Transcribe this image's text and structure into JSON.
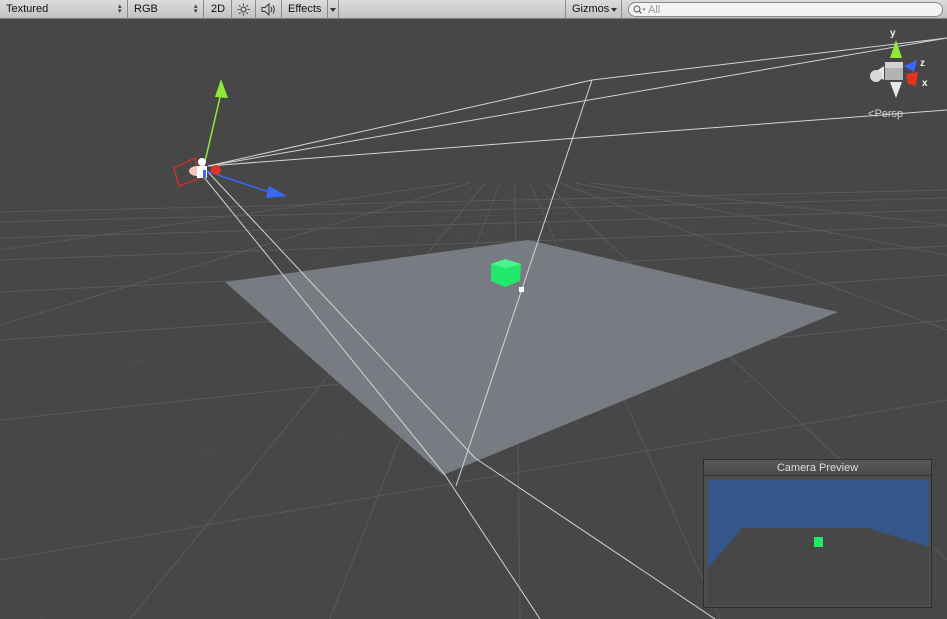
{
  "toolbar": {
    "shading_mode": "Textured",
    "render_channel": "RGB",
    "mode_2d_label": "2D",
    "lighting_icon": "sun-icon",
    "audio_icon": "speaker-icon",
    "effects_label": "Effects",
    "gizmos_label": "Gizmos",
    "search_placeholder": "All"
  },
  "scene": {
    "orientation_gizmo": {
      "axis_y": "y",
      "axis_z": "z",
      "axis_x": "x",
      "projection_label": "Persp"
    },
    "camera_preview": {
      "title": "Camera Preview"
    }
  },
  "colors": {
    "background": "#474747",
    "plane": "#787b81",
    "cube": "#22e86b",
    "axis_y": "#8fe93a",
    "axis_z": "#3a68ff",
    "axis_x": "#e0331e",
    "sky": "#34568a"
  }
}
